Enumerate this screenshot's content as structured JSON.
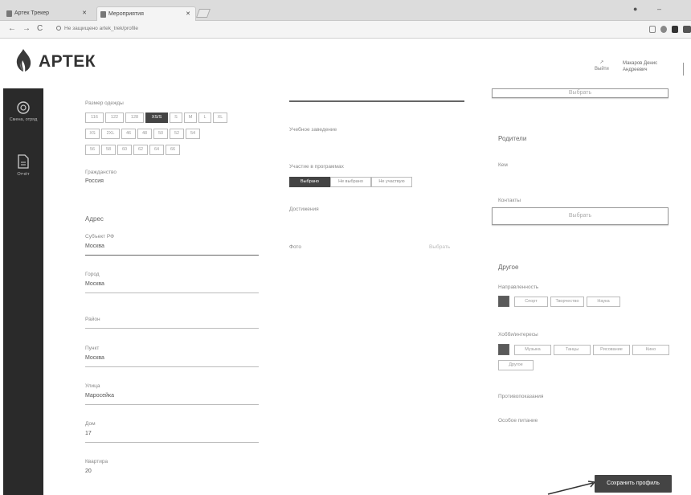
{
  "browser": {
    "tabs": [
      {
        "label": "Артек Трекер"
      },
      {
        "label": "Мероприятия"
      }
    ],
    "url": "Не защищено   artek_trek/profile"
  },
  "header": {
    "brand": "АРТЕК",
    "logout_label": "Выйти",
    "user_name": "Макаров Денис Андреевич"
  },
  "sidebar": {
    "items": [
      {
        "label": "Смена, отряд",
        "icon": "compass-icon"
      },
      {
        "label": "Отчёт",
        "icon": "document-icon"
      }
    ]
  },
  "left": {
    "size_label": "Размер одежды",
    "sizes_row1": [
      "116",
      "122",
      "128",
      "XS/S",
      "S",
      "M",
      "L",
      "XL"
    ],
    "sizes_row2": [
      "XS",
      "2XL",
      "46",
      "48",
      "50",
      "52",
      "54"
    ],
    "sizes_row3": [
      "56",
      "58",
      "60",
      "62",
      "64",
      "66"
    ],
    "selected_size": "XS/S",
    "citizenship_label": "Гражданство",
    "citizenship_value": "Россия",
    "address_heading": "Адрес",
    "region_label": "Субъект РФ",
    "region_value": "Москва",
    "city_label": "Город",
    "city_value": "Москва",
    "district_label": "Район",
    "locality_label": "Пункт",
    "locality_value": "Москва",
    "street_label": "Улица",
    "street_value": "Маросейка",
    "house_label": "Дом",
    "house_value": "17",
    "flat_label": "Квартира",
    "flat_value": "20"
  },
  "middle": {
    "school_label": "Учебное заведение",
    "segment_label": "Участие в программах",
    "segments": [
      "Выбрано",
      "Не выбрано",
      "Не участвую"
    ],
    "selected_segment": "Выбрано",
    "achievements_label": "Достижения",
    "photo_label": "Фото",
    "choose_label": "Выбрать"
  },
  "right": {
    "top_button": "Выбрать",
    "parents_heading": "Родители",
    "relation_label": "Кем",
    "contact_label": "Контакты",
    "add_button": "Выбрать",
    "other_heading": "Другое",
    "swatch_color": "#5a5a5a",
    "activity_label": "Направленность",
    "activity_opts": [
      "Спорт",
      "Творчество",
      "Наука"
    ],
    "hobbies_label": "Хобби/интересы",
    "hobby_opts": [
      "Музыка",
      "Танцы",
      "Рисование",
      "Кино"
    ],
    "hobby_extra": "Другое",
    "health_label": "Противопоказания",
    "diet_label": "Особое питание"
  },
  "save_label": "Сохранить профиль"
}
